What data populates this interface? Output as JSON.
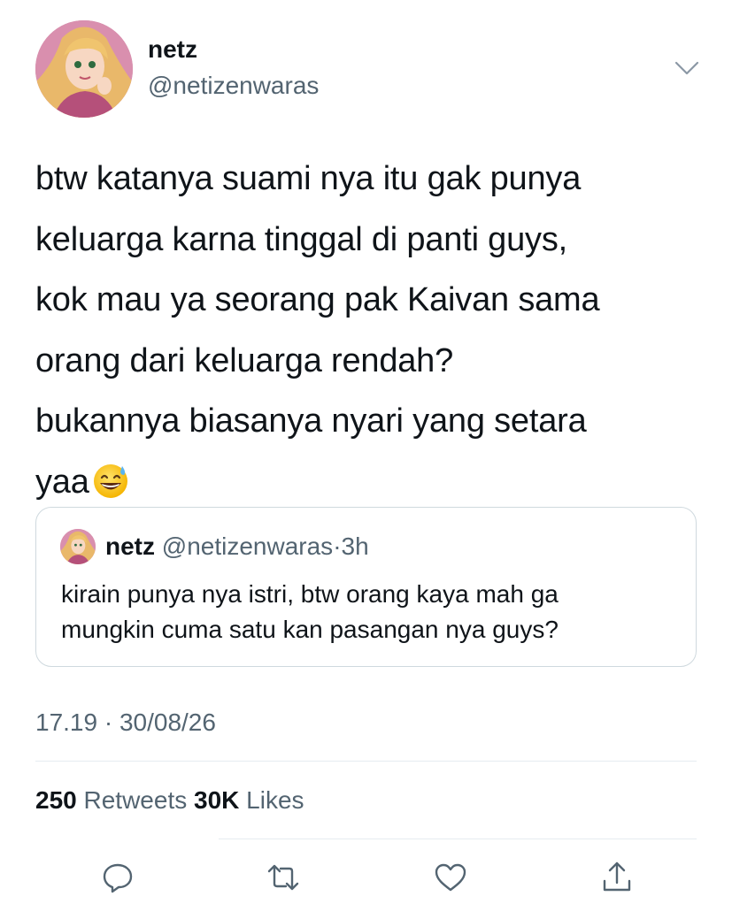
{
  "author": {
    "display_name": "netz",
    "handle": "@netizenwaras",
    "avatar_icon": "avatar-icon"
  },
  "tweet": {
    "lines": [
      "btw katanya suami nya itu gak punya",
      "keluarga karna tinggal di panti guys,",
      "kok mau ya seorang pak Kaivan sama",
      "orang dari keluarga rendah?",
      "bukannya biasanya nyari yang setara",
      "yaa"
    ],
    "trailing_emoji": "grinning-face-with-sweat-icon"
  },
  "quote": {
    "display_name": "netz",
    "handle": "@netizenwaras",
    "separator": "·",
    "time": "3h",
    "lines": [
      "kirain punya nya istri, btw orang kaya mah ga",
      "mungkin cuma satu kan pasangan nya guys?"
    ]
  },
  "meta": {
    "timestamp": "17.19 · 30/08/26"
  },
  "stats": {
    "retweets_count": "250",
    "retweets_label": "Retweets",
    "likes_count": "30K",
    "likes_label": "Likes"
  },
  "actions": [
    "reply-icon",
    "retweet-icon",
    "like-icon",
    "share-icon"
  ],
  "colors": {
    "text_primary": "#0f1419",
    "text_secondary": "#536471",
    "border": "#cfd9de",
    "divider": "#e6ecf0"
  }
}
